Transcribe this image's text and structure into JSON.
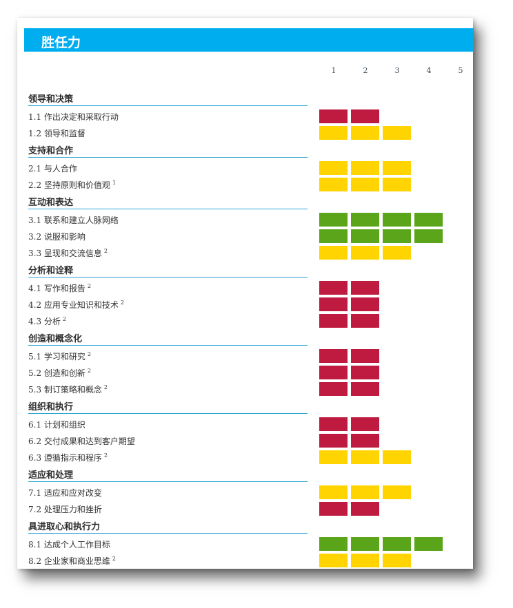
{
  "title": "胜任力",
  "scale": [
    "1",
    "2",
    "3",
    "4",
    "5"
  ],
  "colors": {
    "red": "#bf1a40",
    "yellow": "#ffd400",
    "green": "#5aa51a"
  },
  "groups": [
    {
      "name": "领导和决策",
      "items": [
        {
          "label": "1.1 作出决定和采取行动",
          "note": "",
          "level": 2,
          "color": "red"
        },
        {
          "label": "1.2 领导和监督",
          "note": "",
          "level": 3,
          "color": "yellow"
        }
      ]
    },
    {
      "name": "支持和合作",
      "items": [
        {
          "label": "2.1 与人合作",
          "note": "",
          "level": 3,
          "color": "yellow"
        },
        {
          "label": "2.2 坚持原则和价值观",
          "note": "1",
          "level": 3,
          "color": "yellow"
        }
      ]
    },
    {
      "name": "互动和表达",
      "items": [
        {
          "label": "3.1 联系和建立人脉网络",
          "note": "",
          "level": 4,
          "color": "green"
        },
        {
          "label": "3.2 说服和影响",
          "note": "",
          "level": 4,
          "color": "green"
        },
        {
          "label": "3.3 呈现和交流信息",
          "note": "2",
          "level": 3,
          "color": "yellow"
        }
      ]
    },
    {
      "name": "分析和诠释",
      "items": [
        {
          "label": "4.1 写作和报告",
          "note": "2",
          "level": 2,
          "color": "red"
        },
        {
          "label": "4.2 应用专业知识和技术",
          "note": "2",
          "level": 2,
          "color": "red"
        },
        {
          "label": "4.3 分析",
          "note": "2",
          "level": 2,
          "color": "red"
        }
      ]
    },
    {
      "name": "创造和概念化",
      "items": [
        {
          "label": "5.1 学习和研究",
          "note": "2",
          "level": 2,
          "color": "red"
        },
        {
          "label": "5.2 创造和创新",
          "note": "2",
          "level": 2,
          "color": "red"
        },
        {
          "label": "5.3 制订策略和概念",
          "note": "2",
          "level": 2,
          "color": "red"
        }
      ]
    },
    {
      "name": "组织和执行",
      "items": [
        {
          "label": "6.1 计划和组织",
          "note": "",
          "level": 2,
          "color": "red"
        },
        {
          "label": "6.2 交付成果和达到客户期望",
          "note": "",
          "level": 2,
          "color": "red"
        },
        {
          "label": "6.3 遵循指示和程序",
          "note": "2",
          "level": 3,
          "color": "yellow"
        }
      ]
    },
    {
      "name": "适应和处理",
      "items": [
        {
          "label": "7.1 适应和应对改变",
          "note": "",
          "level": 3,
          "color": "yellow"
        },
        {
          "label": "7.2 处理压力和挫折",
          "note": "",
          "level": 2,
          "color": "red"
        }
      ]
    },
    {
      "name": "具进取心和执行力",
      "items": [
        {
          "label": "8.1 达成个人工作目标",
          "note": "",
          "level": 4,
          "color": "green"
        },
        {
          "label": "8.2 企业家和商业思维",
          "note": "2",
          "level": 3,
          "color": "yellow"
        }
      ]
    }
  ]
}
